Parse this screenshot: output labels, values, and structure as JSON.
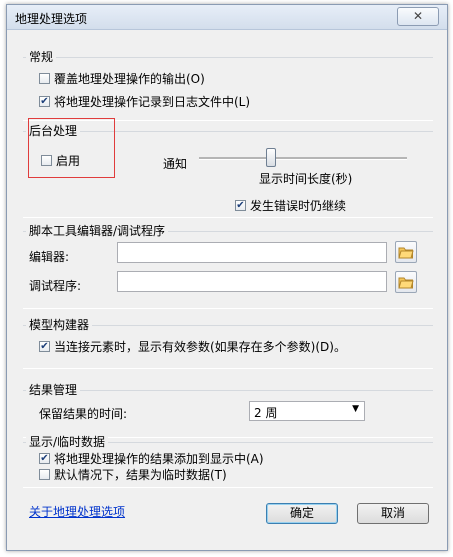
{
  "window": {
    "title": "地理处理选项",
    "close_glyph": "✕"
  },
  "general": {
    "title": "常规",
    "overwrite": {
      "label": "覆盖地理处理操作的输出(O)",
      "checked": false
    },
    "log": {
      "label": "将地理处理操作记录到日志文件中(L)",
      "checked": true
    }
  },
  "background": {
    "title": "后台处理",
    "enable": {
      "label": "启用",
      "checked": false
    },
    "notify_label": "通知",
    "duration_label": "显示时间长度(秒)",
    "continue_on_error": {
      "label": "发生错误时仍继续",
      "checked": true
    }
  },
  "script_editor": {
    "title": "脚本工具编辑器/调试程序",
    "editor_label": "编辑器:",
    "editor_value": "",
    "debugger_label": "调试程序:",
    "debugger_value": ""
  },
  "model_builder": {
    "title": "模型构建器",
    "show_params": {
      "label": "当连接元素时，显示有效参数(如果存在多个参数)(D)。",
      "checked": true
    }
  },
  "results": {
    "title": "结果管理",
    "keep_label": "保留结果的时间:",
    "keep_value": "2 周"
  },
  "display": {
    "title": "显示/临时数据",
    "add_to_display": {
      "label": "将地理处理操作的结果添加到显示中(A)",
      "checked": true
    },
    "temporary": {
      "label": "默认情况下，结果为临时数据(T)",
      "checked": false
    }
  },
  "footer": {
    "about_link": "关于地理处理选项",
    "ok": "确定",
    "cancel": "取消"
  },
  "checkmark": "✔"
}
